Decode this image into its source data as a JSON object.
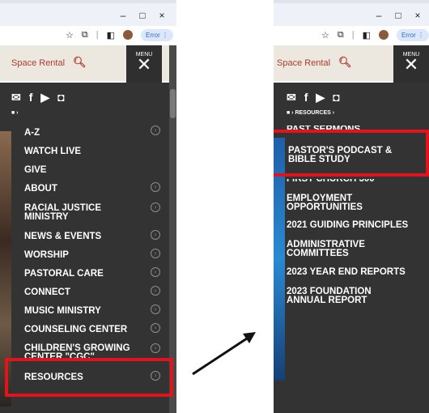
{
  "left": {
    "window_controls": [
      "–",
      "□",
      "×"
    ],
    "error_label": "Error",
    "search_link": "Space Rental",
    "menu_label": "MENU",
    "menu_close": "✕",
    "breadcrumb": "■ ›",
    "items": [
      {
        "label": "A-Z",
        "chevron": true
      },
      {
        "label": "WATCH LIVE",
        "chevron": false
      },
      {
        "label": "GIVE",
        "chevron": false
      },
      {
        "label": "ABOUT",
        "chevron": true
      },
      {
        "label": "RACIAL JUSTICE MINISTRY",
        "chevron": true
      },
      {
        "label": "NEWS & EVENTS",
        "chevron": true
      },
      {
        "label": "WORSHIP",
        "chevron": true
      },
      {
        "label": "PASTORAL CARE",
        "chevron": true
      },
      {
        "label": "CONNECT",
        "chevron": true
      },
      {
        "label": "MUSIC MINISTRY",
        "chevron": true
      },
      {
        "label": "COUNSELING CENTER",
        "chevron": true
      },
      {
        "label": "CHILDREN'S GROWING CENTER \"CGC\"",
        "chevron": true
      },
      {
        "label": "RESOURCES",
        "chevron": true
      }
    ]
  },
  "right": {
    "window_controls": [
      "–",
      "□",
      "×"
    ],
    "error_label": "Error",
    "search_link": "Space Rental",
    "menu_label": "MENU",
    "menu_close": "✕",
    "breadcrumb": "■ › RESOURCES ›",
    "items": [
      {
        "label": "PAST SERMONS"
      },
      {
        "label": "PASTOR'S PODCAST & BIBLE STUDY"
      },
      {
        "label": "FIRST CHURCH 300"
      },
      {
        "label": "EMPLOYMENT OPPORTUNITIES"
      },
      {
        "label": "2021 GUIDING PRINCIPLES"
      },
      {
        "label": "ADMINISTRATIVE COMMITTEES"
      },
      {
        "label": "2023 YEAR END REPORTS"
      },
      {
        "label": "2023 FOUNDATION ANNUAL REPORT"
      }
    ]
  },
  "colors": {
    "highlight": "#e1131c",
    "menu_bg": "#333333",
    "accent": "#b23b2e"
  }
}
